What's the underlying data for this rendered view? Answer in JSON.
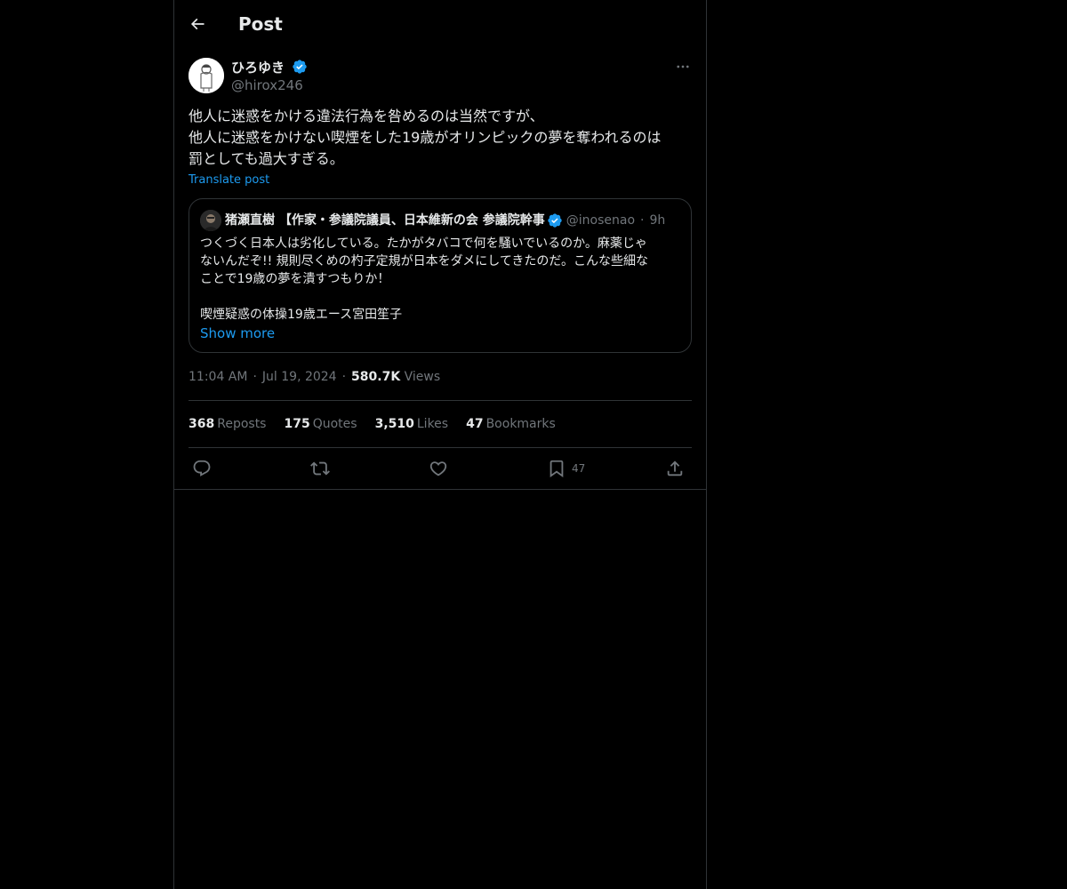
{
  "header": {
    "title": "Post"
  },
  "author": {
    "name": "ひろゆき",
    "handle": "@hirox246"
  },
  "post": {
    "lines": [
      "他人に迷惑をかける違法行為を咎めるのは当然ですが、",
      "他人に迷惑をかけない喫煙をした19歳がオリンピックの夢を奪われるのは",
      "罰としても過大すぎる。"
    ],
    "translate_label": "Translate post"
  },
  "quote": {
    "name": "猪瀬直樹 【作家・参議院議員、日本維新の会 参議院幹事",
    "handle": "@inosenao",
    "time": "9h",
    "lines": [
      "つくづく日本人は劣化している。たかがタバコで何を騒いでいるのか。麻薬じゃ",
      "ないんだぞ!! 規則尽くめの杓子定規が日本をダメにしてきたのだ。こんな些細な",
      "ことで19歳の夢を潰すつもりか！",
      "",
      "喫煙疑惑の体操19歳エース宮田笙子"
    ],
    "show_more": "Show more"
  },
  "meta": {
    "time": "11:04 AM",
    "date": "Jul 19, 2024",
    "views_count": "580.7K",
    "views_label": "Views"
  },
  "stats": {
    "reposts": {
      "num": "368",
      "label": "Reposts"
    },
    "quotes": {
      "num": "175",
      "label": "Quotes"
    },
    "likes": {
      "num": "3,510",
      "label": "Likes"
    },
    "bookmarks": {
      "num": "47",
      "label": "Bookmarks"
    }
  },
  "actions": {
    "bookmark_count": "47"
  },
  "colors": {
    "background": "#000000",
    "text": "#e7e9ea",
    "secondary": "#71767b",
    "accent": "#1d9bf0",
    "border": "#2f3336"
  }
}
